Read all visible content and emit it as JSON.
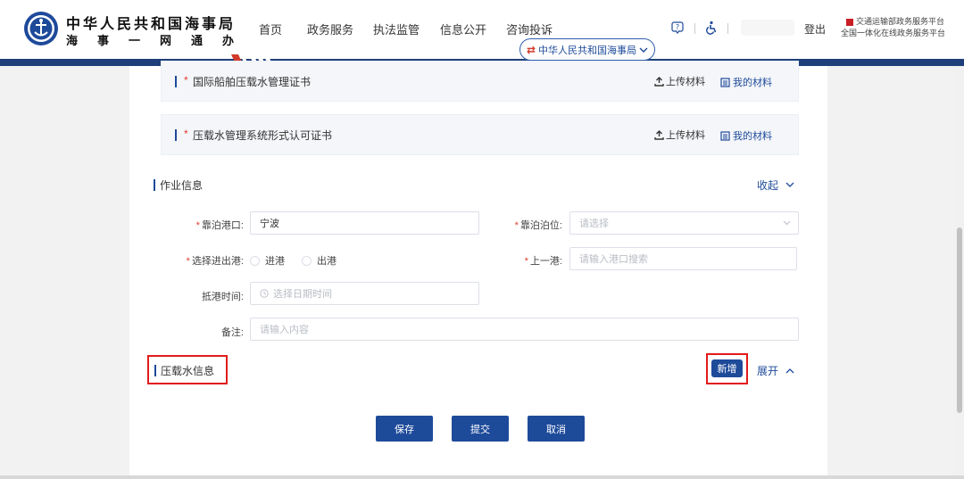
{
  "header": {
    "org_name": "中华人民共和国海事局",
    "org_sub": "海事一网通办",
    "nav": [
      "首页",
      "政务服务",
      "执法监管",
      "信息公开",
      "咨询投诉"
    ],
    "dropdown_label": "中华人民共和国海事局",
    "logout": "登出",
    "platform_line1": "交通运输部政务服务平台",
    "platform_line2": "全国一体化在线政务服务平台",
    "brand_color": "#1e3f7a"
  },
  "certificates": [
    {
      "required_mark": "*",
      "label": "国际船舶压载水管理证书",
      "upload": "上传材料",
      "mine": "我的材料"
    },
    {
      "required_mark": "*",
      "label": "压载水管理系统形式认可证书",
      "upload": "上传材料",
      "mine": "我的材料"
    }
  ],
  "work_section": {
    "title": "作业信息",
    "toggle": "收起"
  },
  "form": {
    "port": {
      "required_mark": "*",
      "label": "靠泊港口:",
      "value": "宁波"
    },
    "berth": {
      "required_mark": "*",
      "label": "靠泊泊位:",
      "placeholder": "请选择"
    },
    "direction": {
      "required_mark": "*",
      "label": "选择进出港:",
      "options": [
        "进港",
        "出港"
      ]
    },
    "last_port": {
      "required_mark": "*",
      "label": "上一港:",
      "placeholder": "请输入港口搜索"
    },
    "arrival": {
      "label": "抵港时间:",
      "placeholder": "选择日期时间"
    },
    "remark": {
      "label": "备注:",
      "placeholder": "请输入内容"
    }
  },
  "ballast_section": {
    "title": "压载水信息",
    "add_button": "新增",
    "toggle": "展开"
  },
  "actions": {
    "save": "保存",
    "submit": "提交",
    "cancel": "取消"
  }
}
